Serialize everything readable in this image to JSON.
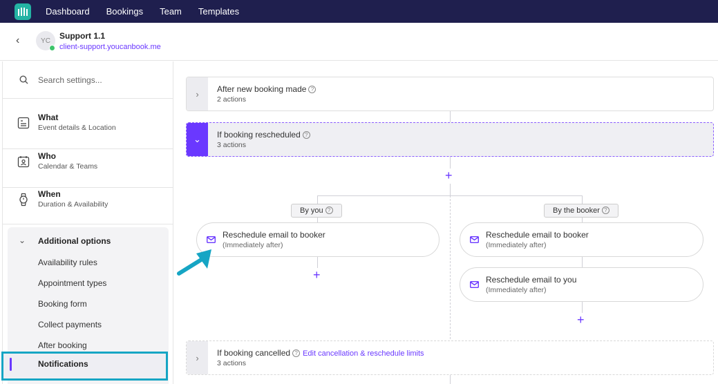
{
  "nav": {
    "items": [
      "Dashboard",
      "Bookings",
      "Team",
      "Templates"
    ]
  },
  "header": {
    "title": "Support 1.1",
    "subtitle": "client-support.youcanbook.me",
    "avatar_initials": "YC"
  },
  "sidebar": {
    "search_placeholder": "Search settings...",
    "sections": [
      {
        "title": "What",
        "subtitle": "Event details & Location",
        "icon": "document-icon"
      },
      {
        "title": "Who",
        "subtitle": "Calendar & Teams",
        "icon": "contact-card-icon"
      },
      {
        "title": "When",
        "subtitle": "Duration & Availability",
        "icon": "watch-icon"
      }
    ],
    "additional": {
      "label": "Additional options",
      "items": [
        "Availability rules",
        "Appointment types",
        "Booking form",
        "Collect payments",
        "After booking",
        "Notifications"
      ]
    }
  },
  "workflow": {
    "after_new": {
      "title": "After new booking made",
      "subtitle": "2 actions"
    },
    "rescheduled": {
      "title": "If booking rescheduled",
      "subtitle": "3 actions"
    },
    "branches": {
      "by_you": "By you",
      "by_booker": "By the booker"
    },
    "actions_you": [
      {
        "title": "Reschedule email to booker",
        "subtitle": "(Immediately after)"
      }
    ],
    "actions_booker": [
      {
        "title": "Reschedule email to booker",
        "subtitle": "(Immediately after)"
      },
      {
        "title": "Reschedule email to you",
        "subtitle": "(Immediately after)"
      }
    ],
    "cancelled": {
      "title": "If booking cancelled",
      "link": "Edit cancellation & reschedule limits",
      "subtitle": "3 actions"
    }
  },
  "colors": {
    "accent": "#6a38ff",
    "topbar": "#1f1f4e",
    "highlight": "#16a5c4"
  }
}
